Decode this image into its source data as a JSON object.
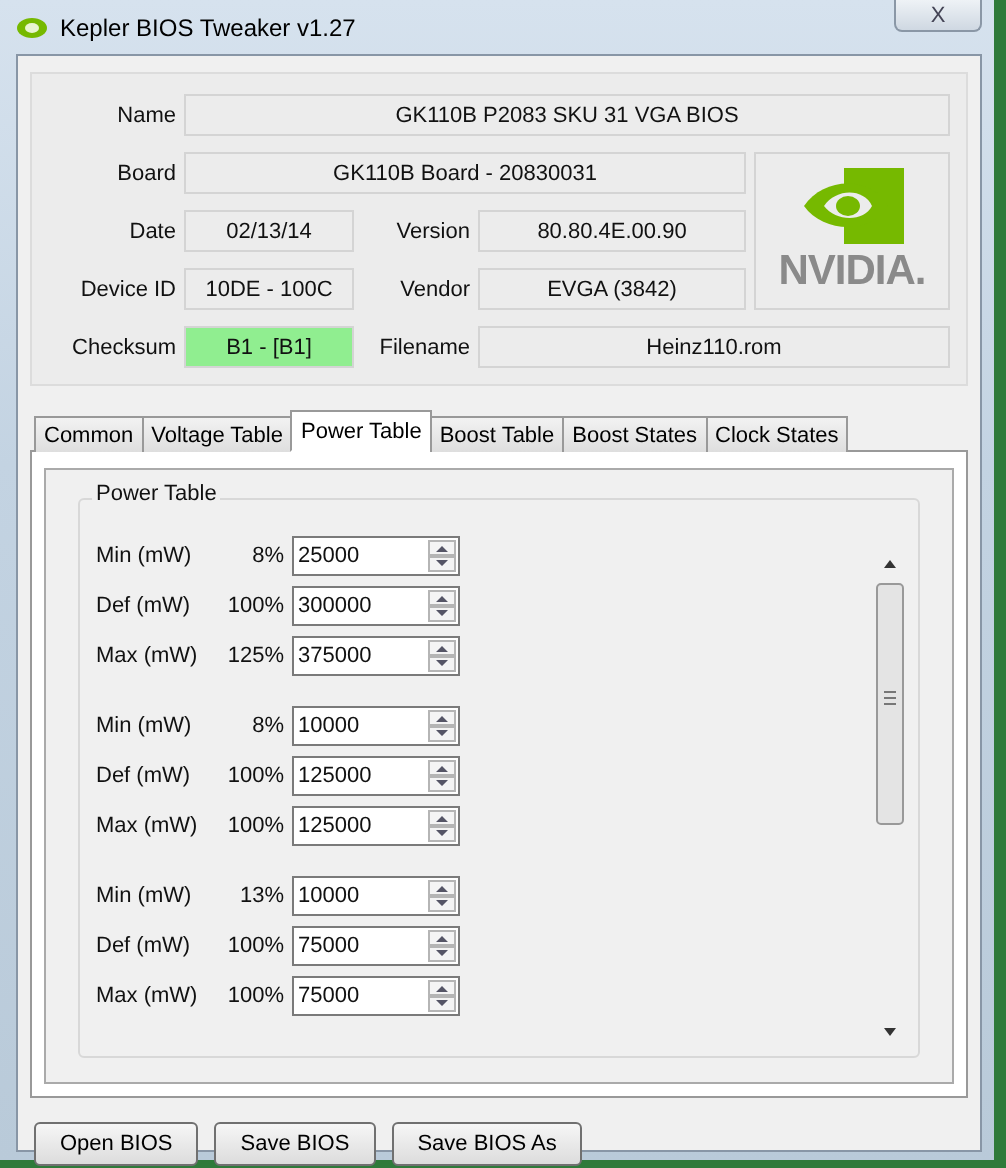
{
  "window": {
    "title": "Kepler BIOS Tweaker v1.27",
    "close_label": "X"
  },
  "info": {
    "name": {
      "label": "Name",
      "value": "GK110B P2083 SKU 31 VGA BIOS"
    },
    "board": {
      "label": "Board",
      "value": "GK110B Board - 20830031"
    },
    "date": {
      "label": "Date",
      "value": "02/13/14"
    },
    "version": {
      "label": "Version",
      "value": "80.80.4E.00.90"
    },
    "device_id": {
      "label": "Device ID",
      "value": "10DE - 100C"
    },
    "vendor": {
      "label": "Vendor",
      "value": "EVGA (3842)"
    },
    "checksum": {
      "label": "Checksum",
      "value": "B1 - [B1]",
      "color": "#90ee90"
    },
    "filename": {
      "label": "Filename",
      "value": "Heinz110.rom"
    },
    "logo_text": "NVIDIA."
  },
  "tabs": [
    {
      "label": "Common",
      "selected": false
    },
    {
      "label": "Voltage Table",
      "selected": false
    },
    {
      "label": "Power Table",
      "selected": true
    },
    {
      "label": "Boost Table",
      "selected": false
    },
    {
      "label": "Boost States",
      "selected": false
    },
    {
      "label": "Clock States",
      "selected": false
    }
  ],
  "power_table": {
    "title": "Power Table",
    "groups": [
      {
        "rows": [
          {
            "label": "Min (mW)",
            "percent": "8%",
            "value": "25000"
          },
          {
            "label": "Def (mW)",
            "percent": "100%",
            "value": "300000"
          },
          {
            "label": "Max (mW)",
            "percent": "125%",
            "value": "375000"
          }
        ]
      },
      {
        "rows": [
          {
            "label": "Min (mW)",
            "percent": "8%",
            "value": "10000"
          },
          {
            "label": "Def (mW)",
            "percent": "100%",
            "value": "125000"
          },
          {
            "label": "Max (mW)",
            "percent": "100%",
            "value": "125000"
          }
        ]
      },
      {
        "rows": [
          {
            "label": "Min (mW)",
            "percent": "13%",
            "value": "10000"
          },
          {
            "label": "Def (mW)",
            "percent": "100%",
            "value": "75000"
          },
          {
            "label": "Max (mW)",
            "percent": "100%",
            "value": "75000"
          }
        ]
      }
    ]
  },
  "buttons": [
    "Open BIOS",
    "Save BIOS",
    "Save BIOS As"
  ]
}
